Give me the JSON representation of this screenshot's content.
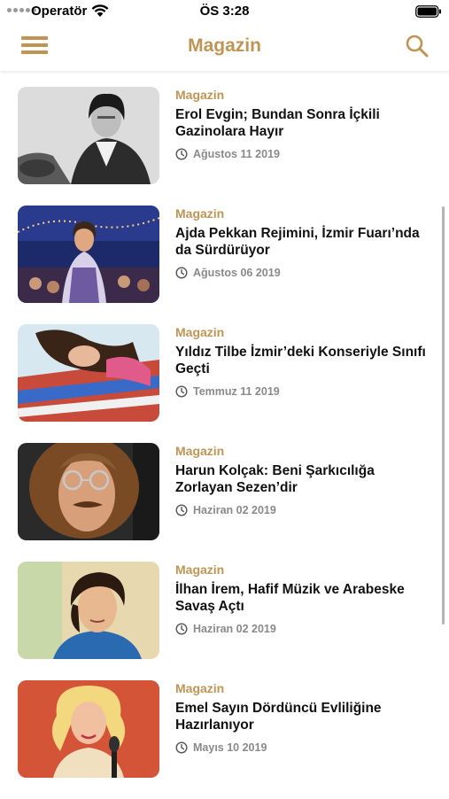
{
  "status_bar": {
    "carrier": "Operatör",
    "time": "ÖS 3:28"
  },
  "navbar": {
    "title": "Magazin"
  },
  "colors": {
    "accent": "#c09553",
    "date_gray": "#8a8a8a"
  },
  "articles": [
    {
      "category": "Magazin",
      "title": "Erol Evgin; Bundan Sonra İçkili Gazinolara Hayır",
      "date": "Ağustos 11 2019",
      "image": "bw-portrait-guitar"
    },
    {
      "category": "Magazin",
      "title": "Ajda Pekkan Rejimini, İzmir Fuarı’nda da Sürdürüyor",
      "date": "Ağustos 06 2019",
      "image": "concert-stage-night"
    },
    {
      "category": "Magazin",
      "title": "Yıldız Tilbe İzmir’deki Konseriyle Sınıfı Geçti",
      "date": "Temmuz 11 2019",
      "image": "colorful-portrait"
    },
    {
      "category": "Magazin",
      "title": "Harun Kolçak: Beni Şarkıcılığa Zorlayan Sezen’dir",
      "date": "Haziran 02 2019",
      "image": "curly-hair-glasses-portrait"
    },
    {
      "category": "Magazin",
      "title": "İlhan İrem, Hafif Müzik ve Arabeske Savaş Açtı",
      "date": "Haziran 02 2019",
      "image": "young-man-portrait"
    },
    {
      "category": "Magazin",
      "title": "Emel Sayın Dördüncü Evliliğine Hazırlanıyor",
      "date": "Mayıs 10 2019",
      "image": "blonde-singer-microphone"
    }
  ]
}
